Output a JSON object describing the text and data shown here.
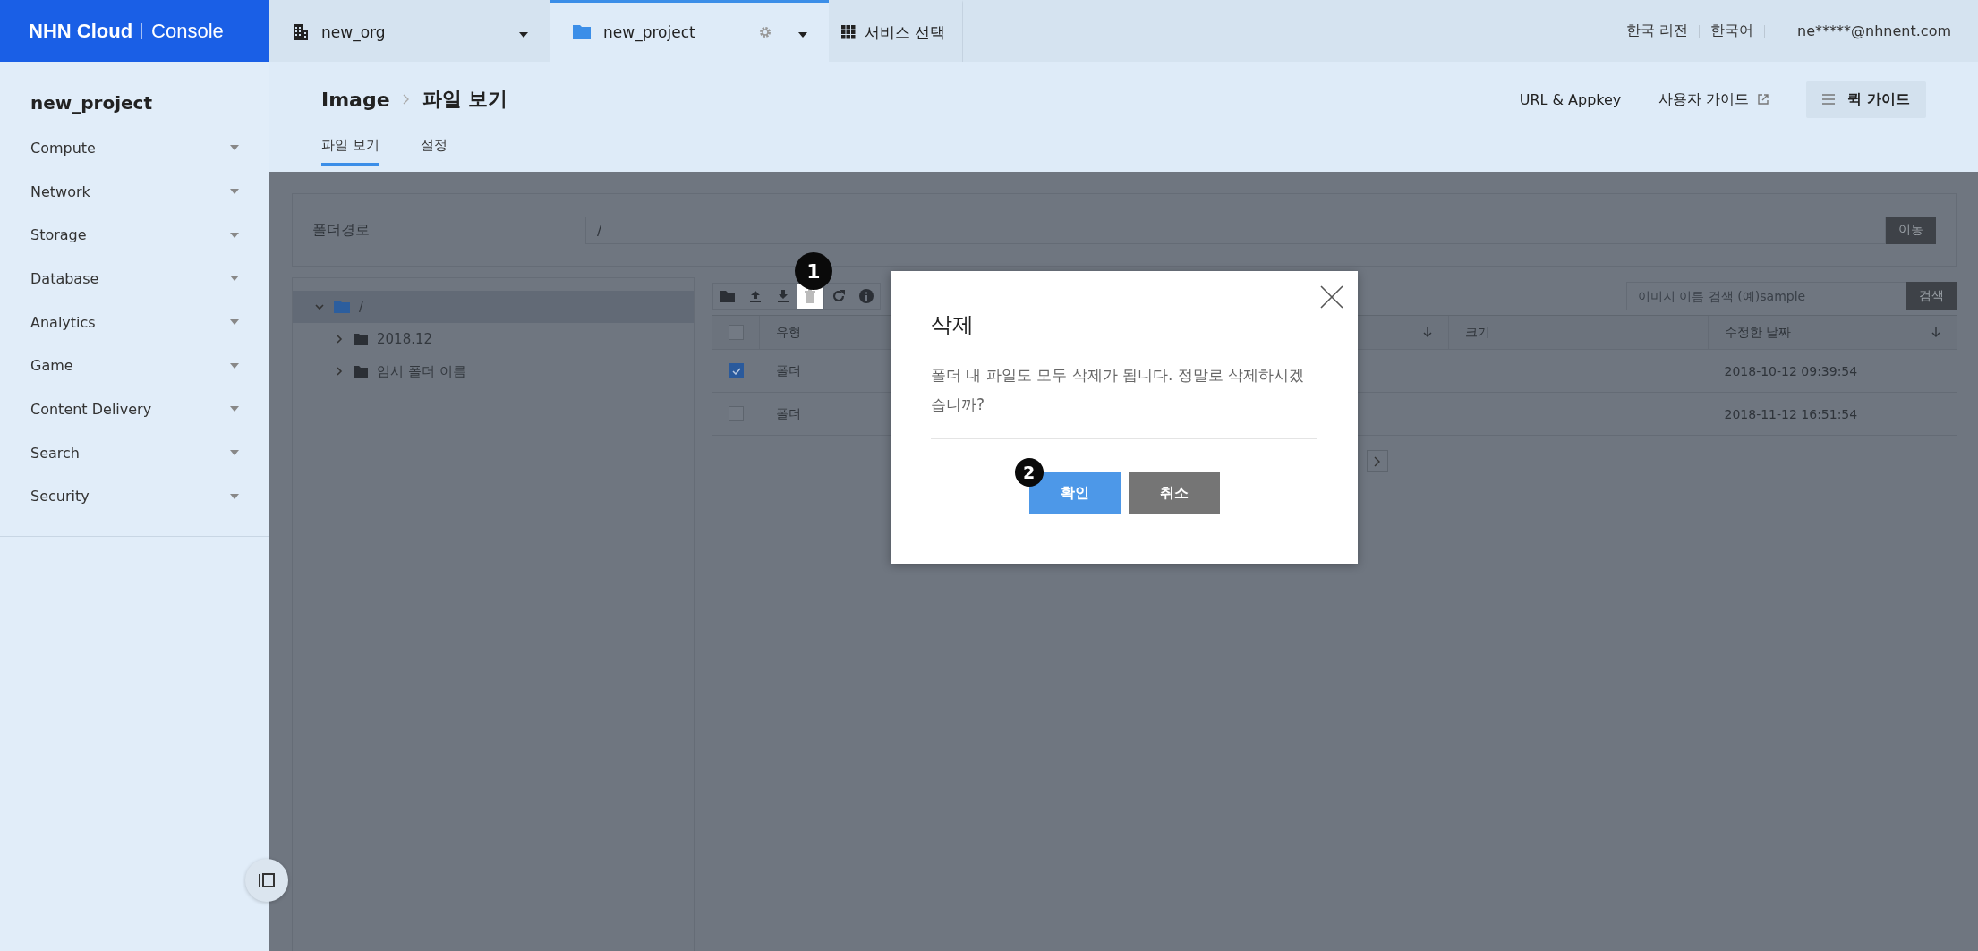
{
  "logo": {
    "brand": "NHN Cloud",
    "product": "Console"
  },
  "top_tabs": [
    {
      "kind": "org",
      "label": "new_org",
      "selected": false
    },
    {
      "kind": "project",
      "label": "new_project",
      "selected": true
    },
    {
      "kind": "services",
      "label": "서비스 선택",
      "selected": false
    }
  ],
  "top_right": {
    "region": "한국 리전",
    "language": "한국어",
    "user": "ne*****@nhnent.com"
  },
  "sidebar": {
    "project": "new_project",
    "items": [
      {
        "label": "Compute"
      },
      {
        "label": "Network"
      },
      {
        "label": "Storage"
      },
      {
        "label": "Database"
      },
      {
        "label": "Analytics"
      },
      {
        "label": "Game"
      },
      {
        "label": "Content Delivery"
      },
      {
        "label": "Search"
      },
      {
        "label": "Security"
      }
    ]
  },
  "header": {
    "breadcrumb": [
      "Image",
      "파일 보기"
    ],
    "links": [
      {
        "label": "URL & Appkey",
        "external": false
      },
      {
        "label": "사용자 가이드",
        "external": true
      }
    ],
    "quick_guide": "퀵 가이드",
    "tabs": [
      {
        "label": "파일 보기",
        "selected": true
      },
      {
        "label": "설정",
        "selected": false
      }
    ]
  },
  "path_bar": {
    "label": "폴더경로",
    "value": "/",
    "button": "이동"
  },
  "tree": [
    {
      "label": "/",
      "selected": true,
      "expanded": true,
      "children": [
        {
          "label": "2018.12",
          "selected": false,
          "expanded": false
        },
        {
          "label": "임시 폴더 이름",
          "selected": false,
          "expanded": false
        }
      ]
    }
  ],
  "toolbar": [
    {
      "kind": "new-folder",
      "highlighted": false
    },
    {
      "kind": "upload",
      "highlighted": false
    },
    {
      "kind": "download",
      "highlighted": false
    },
    {
      "kind": "delete",
      "highlighted": true,
      "step": "1"
    },
    {
      "kind": "refresh",
      "highlighted": false
    },
    {
      "kind": "info",
      "highlighted": false
    }
  ],
  "search": {
    "placeholder": "이미지 이름 검색 (예)sample",
    "button": "검색"
  },
  "table": {
    "select_all_checked": false,
    "columns": [
      {
        "label": "유형",
        "sortable": false
      },
      {
        "sortable": true
      },
      {
        "label": "크기",
        "sortable": false
      },
      {
        "label": "수정한 날짜",
        "sortable": true
      }
    ],
    "rows": [
      {
        "checked": true,
        "type": "폴더",
        "modified": "2018-10-12 09:39:54"
      },
      {
        "checked": false,
        "type": "폴더",
        "modified": "2018-11-12 16:51:54"
      }
    ]
  },
  "dialog": {
    "title": "삭제",
    "message": "폴더 내 파일도 모두 삭제가 됩니다. 정말로 삭제하시겠습니까?",
    "buttons": [
      {
        "label": "확인",
        "kind": "primary",
        "step": "2"
      },
      {
        "label": "취소",
        "kind": "secondary"
      }
    ]
  }
}
